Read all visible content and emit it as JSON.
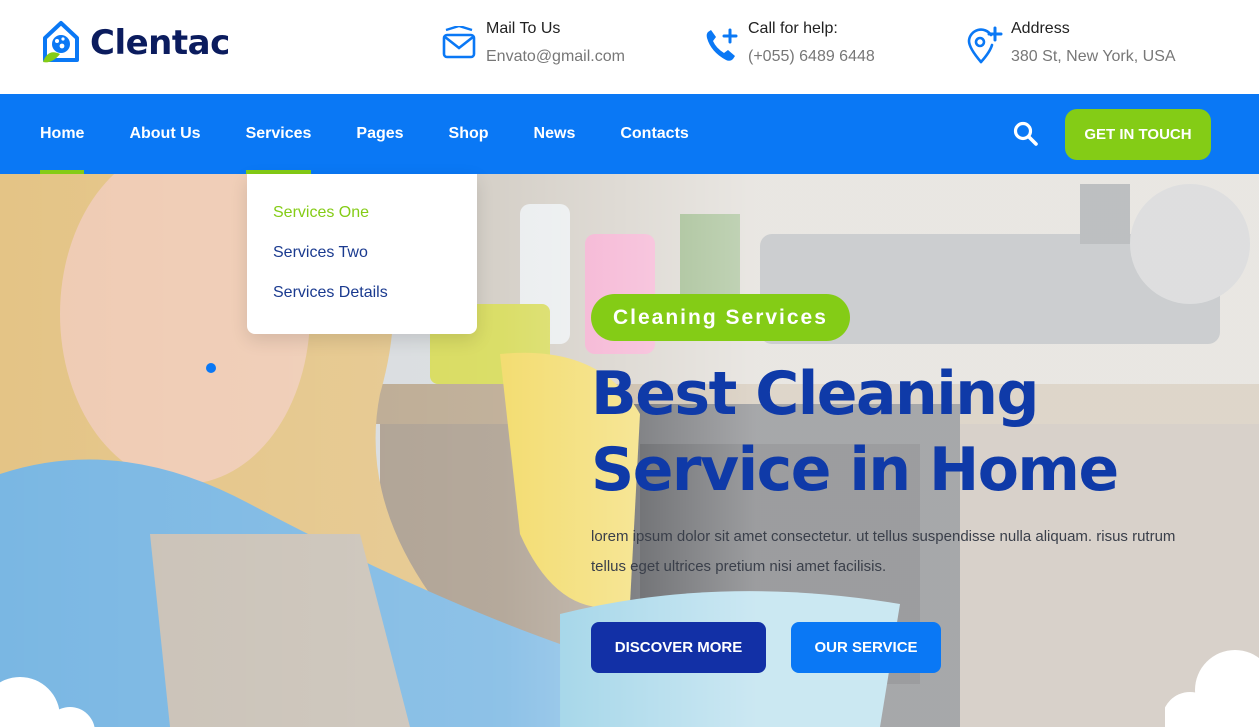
{
  "brand": {
    "name": "Clentac"
  },
  "contact": {
    "mail": {
      "label": "Mail To Us",
      "value": "Envato@gmail.com",
      "icon": "envelope-icon"
    },
    "phone": {
      "label": "Call for help:",
      "value": "(+055) 6489 6448",
      "icon": "phone-icon"
    },
    "address": {
      "label": "Address",
      "value": "380 St, New York, USA",
      "icon": "location-pin-icon"
    }
  },
  "nav": {
    "items": [
      {
        "label": "Home",
        "state": "active"
      },
      {
        "label": "About Us"
      },
      {
        "label": "Services",
        "state": "open"
      },
      {
        "label": "Pages"
      },
      {
        "label": "Shop"
      },
      {
        "label": "News"
      },
      {
        "label": "Contacts"
      }
    ],
    "cta_label": "GET IN TOUCH",
    "search_icon": "search-icon"
  },
  "services_dropdown": {
    "items": [
      {
        "label": "Services One",
        "state": "active"
      },
      {
        "label": "Services Two"
      },
      {
        "label": "Services Details"
      }
    ]
  },
  "hero": {
    "badge": "Cleaning Services",
    "title_line1": "Best Cleaning",
    "title_line2": "Service in Home",
    "text": "lorem ipsum dolor sit amet consectetur. ut tellus suspendisse nulla aliquam. risus rutrum tellus eget ultrices pretium nisi amet facilisis.",
    "primary_button": "DISCOVER MORE",
    "secondary_button": "OUR SERVICE"
  },
  "colors": {
    "brand_blue": "#0a78f5",
    "navy": "#0f3aa8",
    "accent_green": "#84cc16",
    "dark_button": "#1230a6"
  }
}
